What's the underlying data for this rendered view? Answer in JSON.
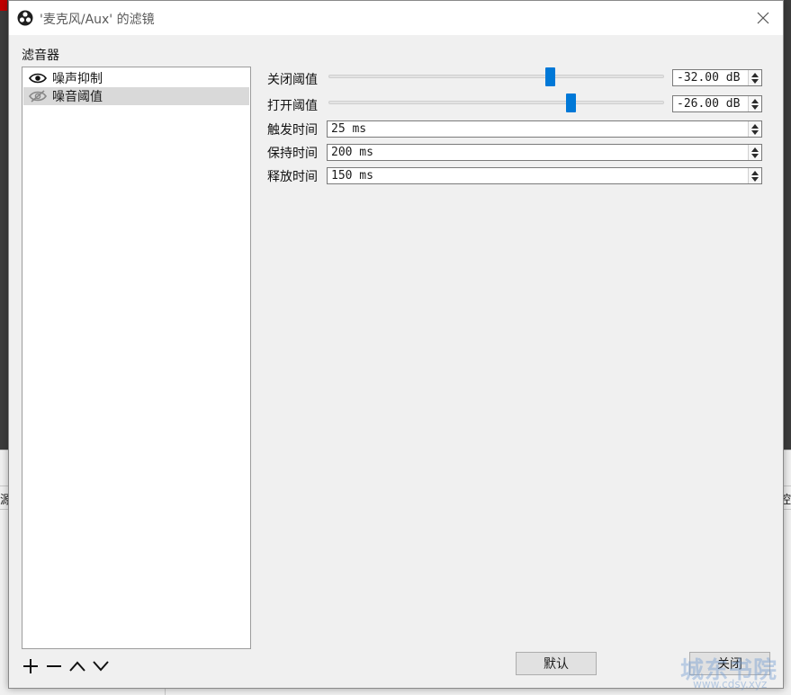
{
  "window": {
    "title": "'麦克风/Aux' 的滤镜",
    "close_label": "×"
  },
  "filters": {
    "label": "滤音器",
    "items": [
      {
        "name": "噪声抑制",
        "visible": true,
        "selected": false
      },
      {
        "name": "噪音阈值",
        "visible": false,
        "selected": true
      }
    ],
    "controls": [
      "add-icon",
      "remove-icon",
      "move-up-icon",
      "move-down-icon"
    ]
  },
  "properties": {
    "close_threshold": {
      "label": "关闭阈值",
      "value": "-32.00 dB"
    },
    "open_threshold": {
      "label": "打开阈值",
      "value": "-26.00 dB"
    },
    "attack_time": {
      "label": "触发时间",
      "value": "25 ms"
    },
    "hold_time": {
      "label": "保持时间",
      "value": "200 ms"
    },
    "release_time": {
      "label": "释放时间",
      "value": "150 ms"
    }
  },
  "buttons": {
    "defaults": "默认",
    "close": "关闭"
  },
  "background": {
    "left_fragment": "源",
    "right_fragment": "控"
  },
  "watermark": {
    "brand": "城东书院",
    "url": "www.cdsy.xyz"
  },
  "colors": {
    "accent": "#0078d7",
    "selection": "#d9d9d9",
    "dialog_bg": "#f0f0f0"
  }
}
